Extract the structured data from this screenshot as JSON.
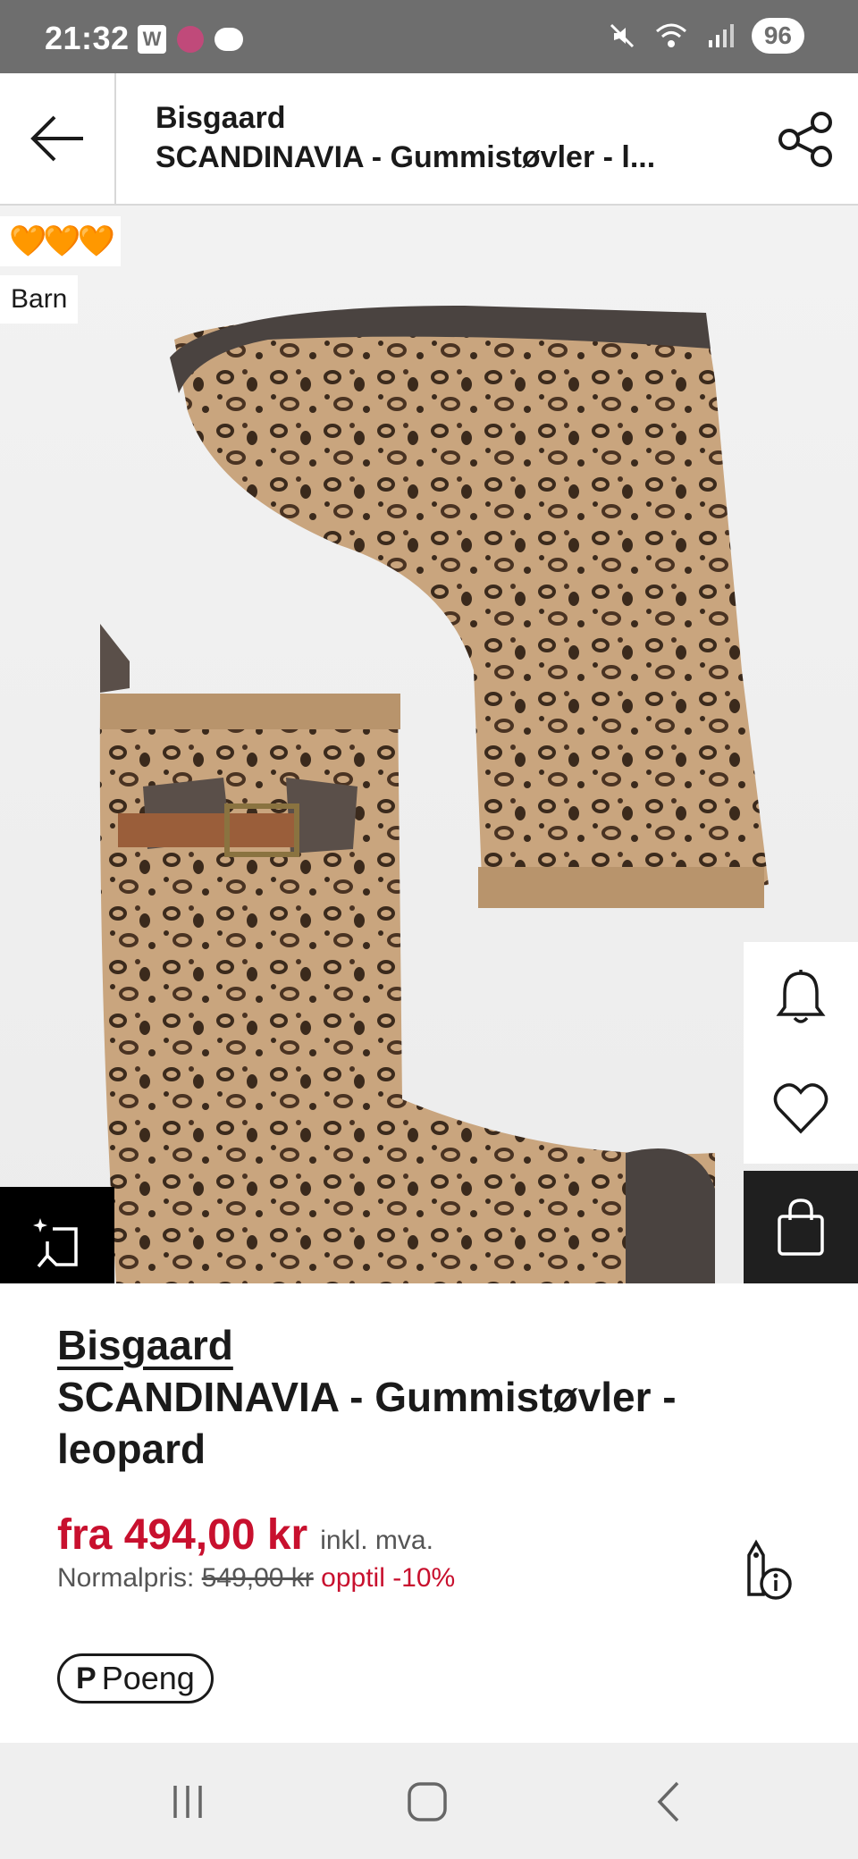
{
  "status_bar": {
    "time": "21:32",
    "w_icon": "W",
    "battery": "96",
    "icons": [
      "w-app-icon",
      "colorful-app-icon",
      "chat-bubble-icon",
      "mute-icon",
      "wifi-icon",
      "signal-icon"
    ]
  },
  "app_bar": {
    "brand": "Bisgaard",
    "product_name": "SCANDINAVIA - Gummistøvler - l...",
    "back_icon": "arrow-left-icon",
    "share_icon": "share-icon"
  },
  "image": {
    "hearts": "🧡🧡🧡",
    "tag": "Barn",
    "buttons": [
      "bell-icon",
      "heart-icon",
      "bag-icon",
      "ai-edit-icon"
    ]
  },
  "product": {
    "brand": "Bisgaard",
    "name": "SCANDINAVIA - Gummistøvler - leopard",
    "price": "fra 494,00 kr",
    "vat": "inkl. mva.",
    "normal_label": "Normalpris:",
    "normal_price": "549,00 kr",
    "discount": "opptil -10%",
    "points": "Poeng",
    "points_mark": "P"
  },
  "colors": {
    "accent_red": "#c8102e",
    "status_bar_bg": "#6e6e6e",
    "dark_button": "#1f1f1f"
  }
}
